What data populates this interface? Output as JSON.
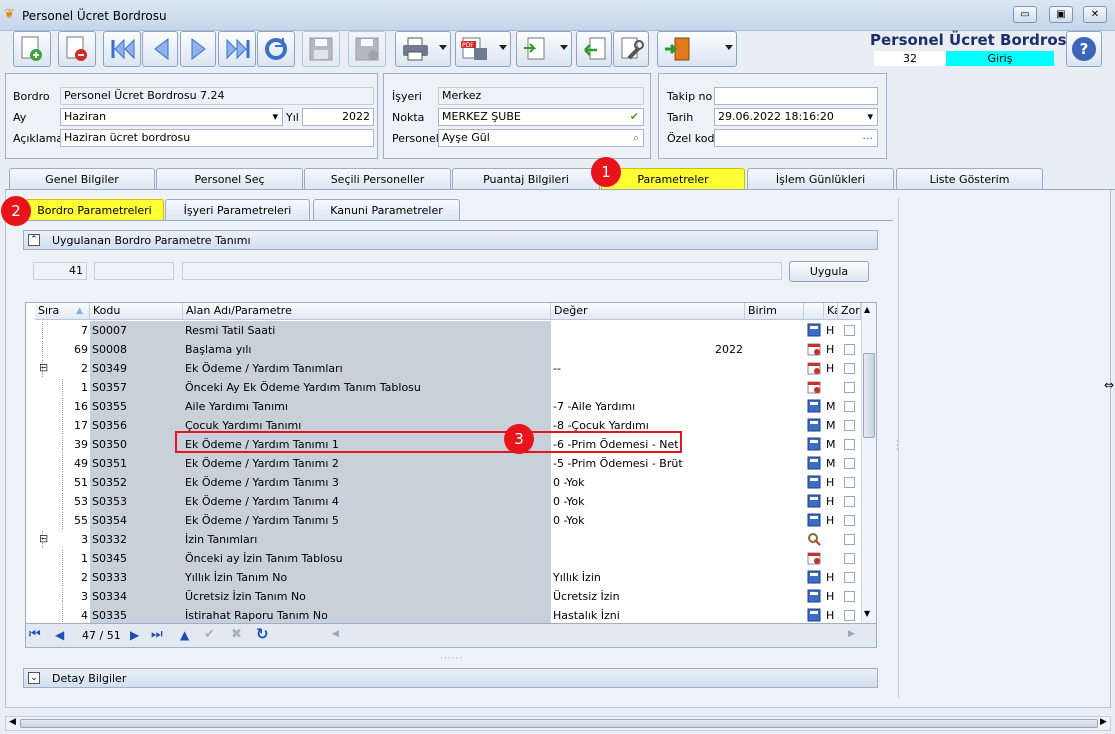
{
  "window": {
    "title": "Personel Ücret Bordrosu",
    "min_glyph": "▭",
    "max_glyph": "▣",
    "close_glyph": "✕"
  },
  "header": {
    "title": "Personel Ücret Bordrosu",
    "record_no": "32",
    "status": "Giriş",
    "help_glyph": "?"
  },
  "colors": {
    "highlight_tab": "#ffff33",
    "badge": "#e8141c",
    "status_bg": "#00ffff",
    "outline": "#e8141c"
  },
  "form": {
    "bordro_label": "Bordro",
    "bordro_value": "Personel Ücret Bordrosu 7.24",
    "ay_label": "Ay",
    "ay_value": "Haziran",
    "yil_label": "Yıl",
    "yil_value": "2022",
    "aciklama_label": "Açıklama",
    "aciklama_value": "Haziran ücret bordrosu",
    "isyeri_label": "İşyeri",
    "isyeri_value": "Merkez",
    "nokta_label": "Nokta",
    "nokta_value": "MERKEZ ŞUBE",
    "personel_label": "Personel",
    "personel_value": "Ayşe Gül",
    "takip_label": "Takip no",
    "takip_value": "",
    "tarih_label": "Tarih",
    "tarih_value": "29.06.2022 18:16:20",
    "ozel_label": "Özel kod",
    "ozel_value": "...",
    "dropdown_glyph": "▾"
  },
  "tabs": [
    "Genel Bilgiler",
    "Personel Seç",
    "Seçili Personeller",
    "Puantaj Bilgileri",
    "Parametreler",
    "İşlem Günlükleri",
    "Liste Gösterim"
  ],
  "subtabs": [
    "Bordro Parametreleri",
    "İşyeri Parametreleri",
    "Kanuni Parametreler"
  ],
  "badges": [
    "1",
    "2",
    "3"
  ],
  "section": {
    "title": "Uygulanan Bordro Parametre Tanımı",
    "count": "41",
    "apply_button": "Uygula",
    "collapse_glyph": "⌃",
    "expand_glyph": "⌄"
  },
  "grid": {
    "columns": [
      "Sıra",
      "Kodu",
      "Alan Adı/Parametre",
      "Değer",
      "Birim",
      "Ka",
      "Zor"
    ],
    "rows": [
      {
        "sira": "7",
        "kod": "S0007",
        "ad": "Resmi Tatil Saati",
        "deger": "",
        "align": "left",
        "ka": "H",
        "icon": "calc",
        "tree": "",
        "indent": 1
      },
      {
        "sira": "69",
        "kod": "S0008",
        "ad": "Başlama yılı",
        "deger": "2022",
        "align": "right",
        "ka": "H",
        "icon": "cal",
        "tree": "",
        "indent": 1
      },
      {
        "sira": "2",
        "kod": "S0349",
        "ad": "Ek Ödeme / Yardım Tanımları",
        "deger": "--",
        "align": "left",
        "ka": "H",
        "icon": "cal",
        "tree": "⊟",
        "indent": 1
      },
      {
        "sira": "1",
        "kod": "S0357",
        "ad": "Önceki Ay Ek Ödeme Yardım Tanım Tablosu",
        "deger": "",
        "align": "left",
        "ka": "",
        "icon": "cal",
        "tree": "",
        "indent": 2
      },
      {
        "sira": "16",
        "kod": "S0355",
        "ad": "Aile Yardımı Tanımı",
        "deger": "-7 -Aile Yardımı",
        "align": "left",
        "ka": "M",
        "icon": "calc",
        "tree": "",
        "indent": 2
      },
      {
        "sira": "17",
        "kod": "S0356",
        "ad": "Çocuk Yardımı Tanımı",
        "deger": "-8 -Çocuk Yardımı",
        "align": "left",
        "ka": "M",
        "icon": "calc",
        "tree": "",
        "indent": 2
      },
      {
        "sira": "39",
        "kod": "S0350",
        "ad": "Ek Ödeme / Yardım Tanımı 1",
        "deger": "-6 -Prim Ödemesi - Net",
        "align": "left",
        "ka": "M",
        "icon": "calc",
        "tree": "",
        "indent": 2
      },
      {
        "sira": "49",
        "kod": "S0351",
        "ad": "Ek Ödeme / Yardım Tanımı 2",
        "deger": "-5 -Prim Ödemesi - Brüt",
        "align": "left",
        "ka": "M",
        "icon": "calc",
        "tree": "",
        "indent": 2
      },
      {
        "sira": "51",
        "kod": "S0352",
        "ad": "Ek Ödeme / Yardım Tanımı 3",
        "deger": "0 -Yok",
        "align": "left",
        "ka": "H",
        "icon": "calc",
        "tree": "",
        "indent": 2
      },
      {
        "sira": "53",
        "kod": "S0353",
        "ad": "Ek Ödeme / Yardım Tanımı 4",
        "deger": "0 -Yok",
        "align": "left",
        "ka": "H",
        "icon": "calc",
        "tree": "",
        "indent": 2
      },
      {
        "sira": "55",
        "kod": "S0354",
        "ad": "Ek Ödeme / Yardım Tanımı 5",
        "deger": "0 -Yok",
        "align": "left",
        "ka": "H",
        "icon": "calc",
        "tree": "",
        "indent": 2
      },
      {
        "sira": "3",
        "kod": "S0332",
        "ad": "İzin Tanımları",
        "deger": "",
        "align": "left",
        "ka": "",
        "icon": "tool",
        "tree": "⊟",
        "indent": 1
      },
      {
        "sira": "1",
        "kod": "S0345",
        "ad": "Önceki ay İzin Tanım Tablosu",
        "deger": "",
        "align": "left",
        "ka": "",
        "icon": "cal",
        "tree": "",
        "indent": 2
      },
      {
        "sira": "2",
        "kod": "S0333",
        "ad": "Yıllık İzin Tanım No",
        "deger": "Yıllık İzin",
        "align": "left",
        "ka": "H",
        "icon": "calc",
        "tree": "",
        "indent": 2
      },
      {
        "sira": "3",
        "kod": "S0334",
        "ad": "Ücretsiz İzin Tanım No",
        "deger": "Ücretsiz İzin",
        "align": "left",
        "ka": "H",
        "icon": "calc",
        "tree": "",
        "indent": 2
      },
      {
        "sira": "4",
        "kod": "S0335",
        "ad": "İstirahat Raporu Tanım No",
        "deger": "Hastalık İzni",
        "align": "left",
        "ka": "H",
        "icon": "calc",
        "tree": "",
        "indent": 2
      }
    ]
  },
  "nav": {
    "position": "47 / 51",
    "first": "⏮",
    "prev": "◀",
    "next": "▶",
    "last": "⏭",
    "up": "▲",
    "ok": "✔",
    "cancel": "✖",
    "refresh": "↻"
  },
  "detail": {
    "title": "Detay Bilgiler"
  }
}
